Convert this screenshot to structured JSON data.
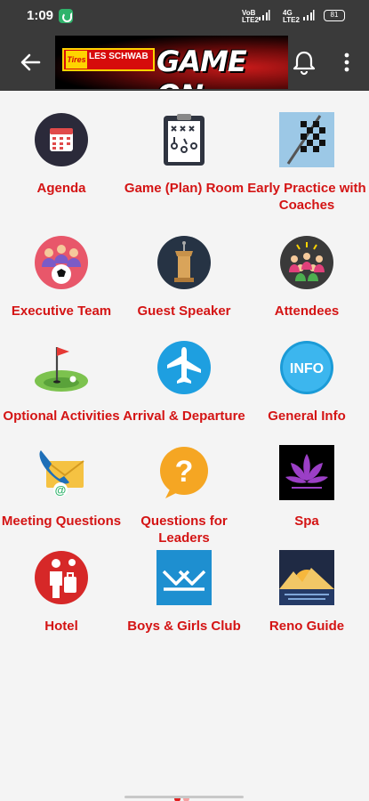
{
  "status_bar": {
    "time": "1:09",
    "net1_top": "VoB",
    "net1_bottom": "LTE2",
    "net2_top": "4G",
    "net2_bottom": "LTE2",
    "battery": "81"
  },
  "app_bar": {
    "banner_brand": "LES SCHWAB",
    "banner_tires": "Tires",
    "banner_title": "GAME ON"
  },
  "colors": {
    "label_red": "#d41414",
    "app_bar_bg": "#3a3a3a",
    "page_bg": "#f4f4f4"
  },
  "tiles": [
    {
      "label": "Agenda",
      "icon": "calendar-icon"
    },
    {
      "label": "Game (Plan) Room",
      "icon": "clipboard-play-icon"
    },
    {
      "label": "Early Practice with Coaches",
      "icon": "checkered-flag-icon"
    },
    {
      "label": "Executive Team",
      "icon": "soccer-team-icon"
    },
    {
      "label": "Guest Speaker",
      "icon": "podium-icon"
    },
    {
      "label": "Attendees",
      "icon": "group-icon"
    },
    {
      "label": "Optional Activities",
      "icon": "golf-icon"
    },
    {
      "label": "Arrival & Departure",
      "icon": "airplane-icon"
    },
    {
      "label": "General Info",
      "icon": "info-icon"
    },
    {
      "label": "Meeting Questions",
      "icon": "phone-email-icon"
    },
    {
      "label": "Questions for Leaders",
      "icon": "question-bubble-icon"
    },
    {
      "label": "Spa",
      "icon": "lotus-icon"
    },
    {
      "label": "Hotel",
      "icon": "hotel-icon"
    },
    {
      "label": "Boys & Girls Club",
      "icon": "club-logo-icon"
    },
    {
      "label": "Reno Guide",
      "icon": "mountain-icon"
    }
  ],
  "pager": {
    "active_color": "#e02020",
    "inactive_color": "#f5a0a0"
  }
}
